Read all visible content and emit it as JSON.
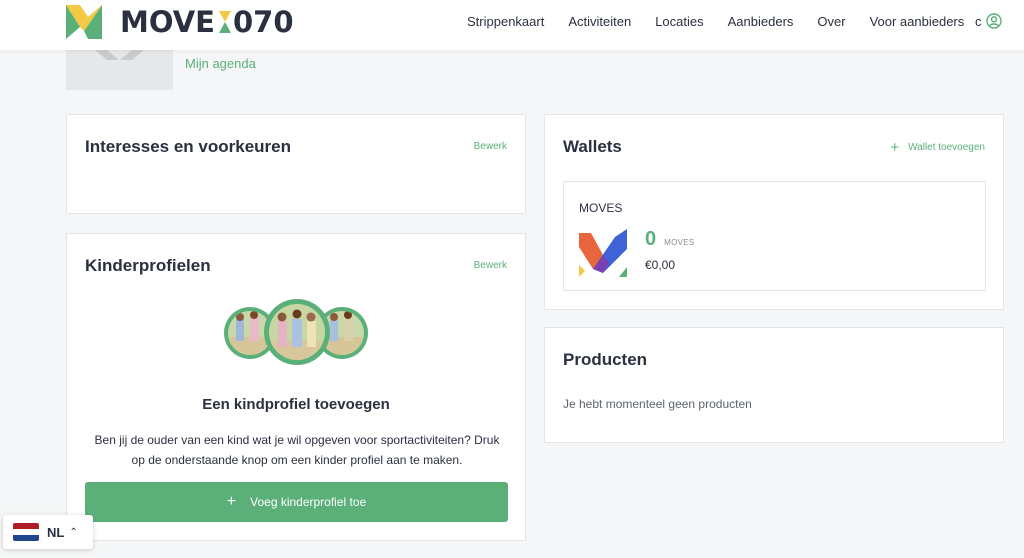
{
  "brand": {
    "name_left": "MOVE",
    "name_right": "070",
    "accent": "#5bb07a"
  },
  "nav": {
    "items": [
      "Strippenkaart",
      "Activiteiten",
      "Locaties",
      "Aanbieders",
      "Over",
      "Voor aanbieders"
    ],
    "user_initial": "c",
    "user_icon": "user-circle-icon"
  },
  "profile": {
    "agenda_link": "Mijn agenda"
  },
  "interests": {
    "title": "Interesses en voorkeuren",
    "edit": "Bewerk"
  },
  "children": {
    "title": "Kinderprofielen",
    "edit": "Bewerk",
    "subtitle": "Een kindprofiel toevoegen",
    "description": "Ben jij de ouder van een kind wat je wil opgeven voor sportactiviteiten? Druk op de onderstaande knop om een kinder profiel aan te maken.",
    "button": "Voeg kinderprofiel toe"
  },
  "wallets": {
    "title": "Wallets",
    "add": "Wallet toevoegen",
    "wallet": {
      "name": "MOVES",
      "amount": "0",
      "unit": "MOVES",
      "euro": "€0,00"
    }
  },
  "products": {
    "title": "Producten",
    "empty": "Je hebt momenteel geen producten"
  },
  "language": {
    "code": "NL",
    "flag_colors": [
      "#ae1c28",
      "#ffffff",
      "#21468b"
    ]
  }
}
